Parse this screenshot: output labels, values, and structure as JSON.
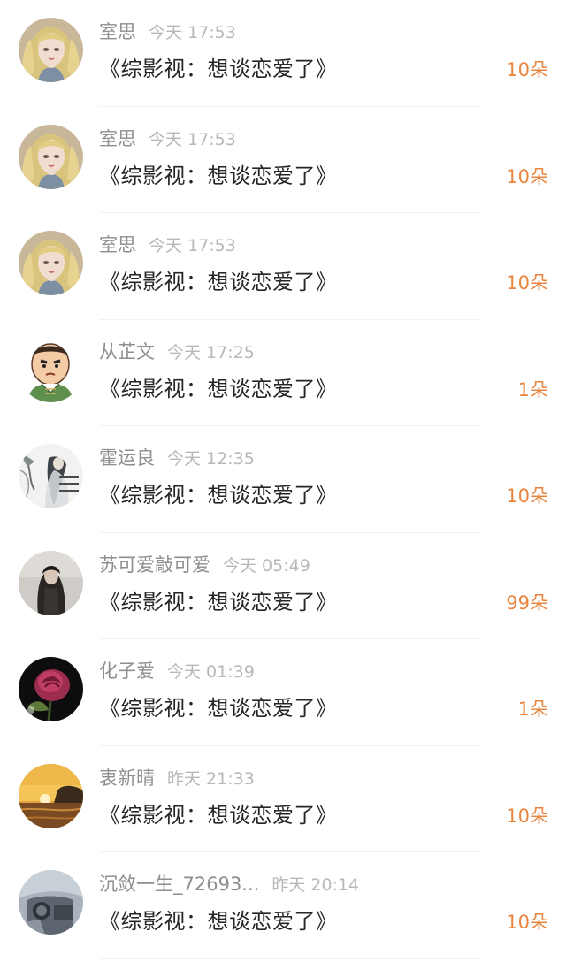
{
  "gift_list": [
    {
      "user": "室思",
      "time": "今天 17:53",
      "title": "《综影视：想谈恋爱了》",
      "amount": "10朵",
      "avatar": "anime-girl-avatar"
    },
    {
      "user": "室思",
      "time": "今天 17:53",
      "title": "《综影视：想谈恋爱了》",
      "amount": "10朵",
      "avatar": "anime-girl-avatar"
    },
    {
      "user": "室思",
      "time": "今天 17:53",
      "title": "《综影视：想谈恋爱了》",
      "amount": "10朵",
      "avatar": "anime-girl-avatar"
    },
    {
      "user": "从芷文",
      "time": "今天 17:25",
      "title": "《综影视：想谈恋爱了》",
      "amount": "1朵",
      "avatar": "cartoon-official-avatar"
    },
    {
      "user": "霍运良",
      "time": "今天 12:35",
      "title": "《综影视：想谈恋爱了》",
      "amount": "10朵",
      "avatar": "ink-painting-avatar"
    },
    {
      "user": "苏可爱敲可爱",
      "time": "今天 05:49",
      "title": "《综影视：想谈恋爱了》",
      "amount": "99朵",
      "avatar": "dark-hair-girl-avatar"
    },
    {
      "user": "化子爱",
      "time": "今天 01:39",
      "title": "《综影视：想谈恋爱了》",
      "amount": "1朵",
      "avatar": "rose-avatar"
    },
    {
      "user": "衷新晴",
      "time": "昨天 21:33",
      "title": "《综影视：想谈恋爱了》",
      "amount": "10朵",
      "avatar": "sunset-sea-avatar"
    },
    {
      "user": "沉敛一生_72693...",
      "time": "昨天 20:14",
      "title": "《综影视：想谈恋爱了》",
      "amount": "10朵",
      "avatar": "car-interior-avatar"
    }
  ],
  "colors": {
    "username": "#8e8e8e",
    "time": "#b8b8b8",
    "title": "#262626",
    "amount": "#e8853e",
    "divider": "#f1f1f1"
  }
}
